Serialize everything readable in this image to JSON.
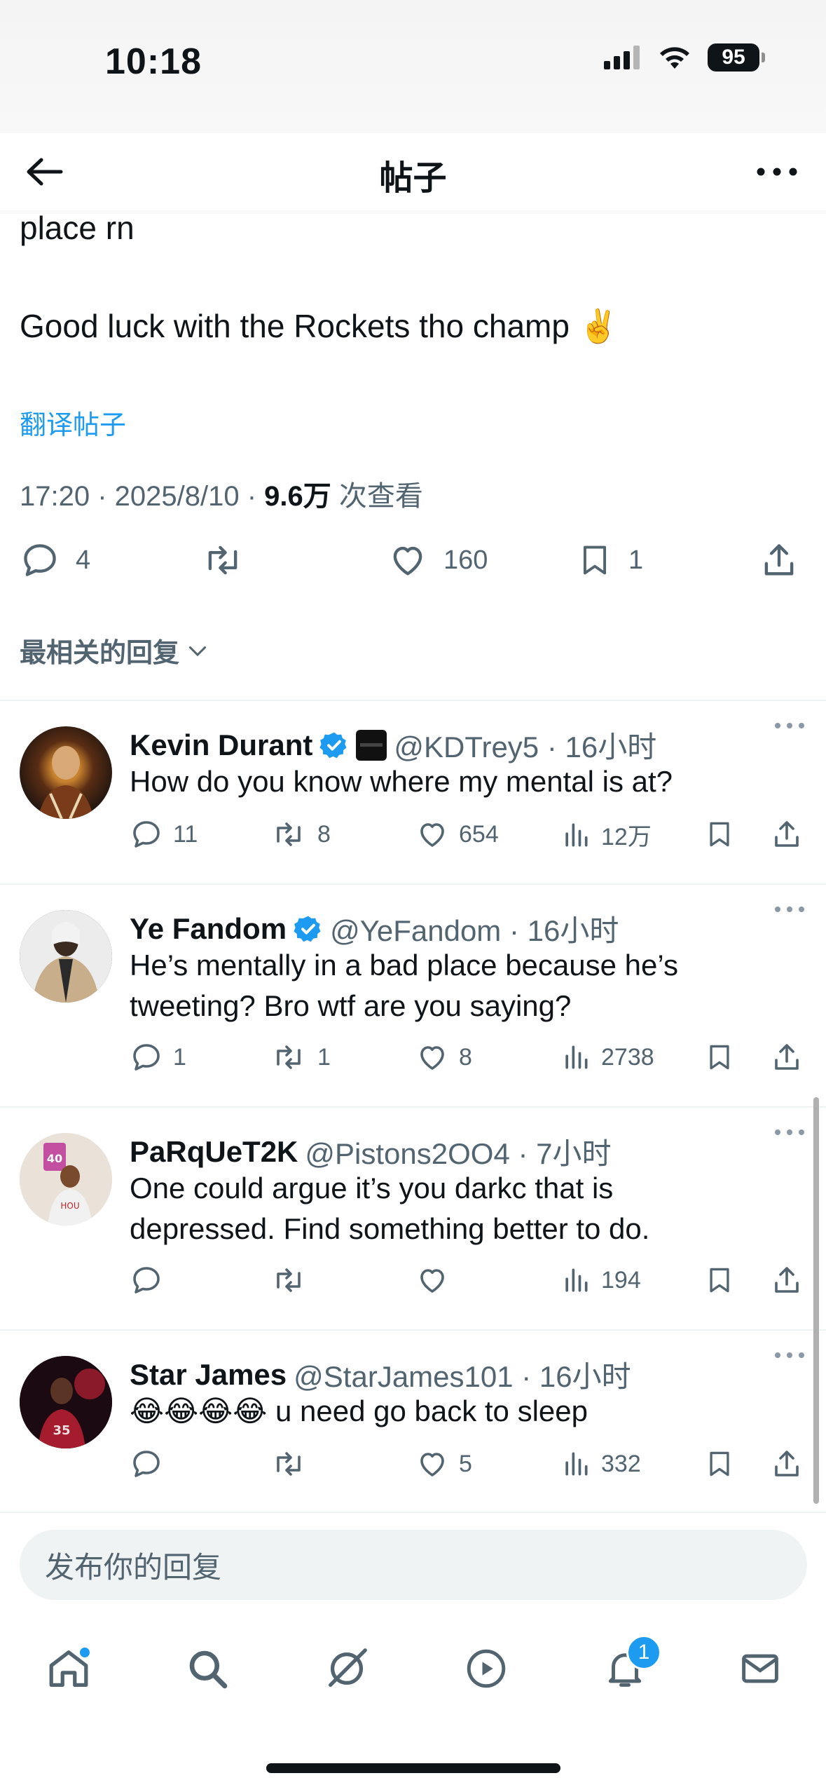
{
  "status": {
    "time": "10:18",
    "battery": "95"
  },
  "header": {
    "title": "帖子"
  },
  "post": {
    "text_line1": "place rn",
    "text_line2": "Good luck with the Rockets tho champ ✌️",
    "translate": "翻译帖子",
    "time": "17:20 · 2025/8/10 · ",
    "views_value": "9.6万",
    "views_label": " 次查看",
    "stats": {
      "replies": "4",
      "likes": "160",
      "bookmarks": "1"
    }
  },
  "sort_label": "最相关的回复",
  "replies": [
    {
      "name": "Kevin Durant",
      "handle": "@KDTrey5 · 16小时",
      "text": "How do you know where my mental is at?",
      "replies": "11",
      "reposts": "8",
      "likes": "654",
      "views": "12万",
      "verified": true,
      "affiliate": true
    },
    {
      "name": "Ye Fandom",
      "handle": "@YeFandom · 16小时",
      "text": "He’s mentally in a bad place because he’s tweeting? Bro wtf are you saying?",
      "replies": "1",
      "reposts": "1",
      "likes": "8",
      "views": "2738",
      "verified": true
    },
    {
      "name": "PaRqUeT2K",
      "handle": "@Pistons2OO4 · 7小时",
      "text": "One could argue it’s you darkc that is depressed. Find something better to do.",
      "replies": "",
      "reposts": "",
      "likes": "",
      "views": "194"
    },
    {
      "name": "Star James",
      "handle": "@StarJames101 · 16小时",
      "text": "😂😂😂😂 u need go back to sleep",
      "replies": "",
      "reposts": "",
      "likes": "5",
      "views": "332"
    }
  ],
  "reply_box": {
    "placeholder": "发布你的回复"
  },
  "tabbar": {
    "notifications_badge": "1"
  },
  "colors": {
    "accent": "#1d9bf0",
    "text": "#0f1419",
    "secondary": "#536471",
    "verified": "#1d9bf0"
  }
}
